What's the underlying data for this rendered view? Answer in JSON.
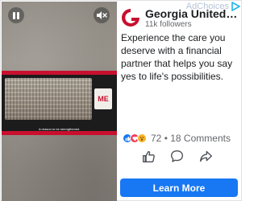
{
  "adchoices": {
    "label": "AdChoices",
    "color": "#b5c3d6"
  },
  "video": {
    "caption": "A reason to be strengthened.",
    "badge_text": "ME",
    "controls": {
      "pause_icon": "pause-icon",
      "mute_icon": "mute-icon"
    },
    "accent_color": "#c8102e"
  },
  "brand": {
    "name": "Georgia United Credit Union",
    "followers": "11k followers",
    "logo_color": "#c8102e"
  },
  "post": {
    "body": "Experience the care you deserve with a financial partner that helps you say yes to life's possibilities."
  },
  "engagement": {
    "reaction_icons": [
      "like-icon",
      "love-icon",
      "wow-icon"
    ],
    "reactions_count": "72",
    "separator": "•",
    "comments": "18 Comments"
  },
  "actions": {
    "like_icon": "thumbs-up-icon",
    "comment_icon": "comment-icon",
    "share_icon": "share-icon"
  },
  "cta": {
    "label": "Learn More",
    "color": "#1877f2"
  }
}
